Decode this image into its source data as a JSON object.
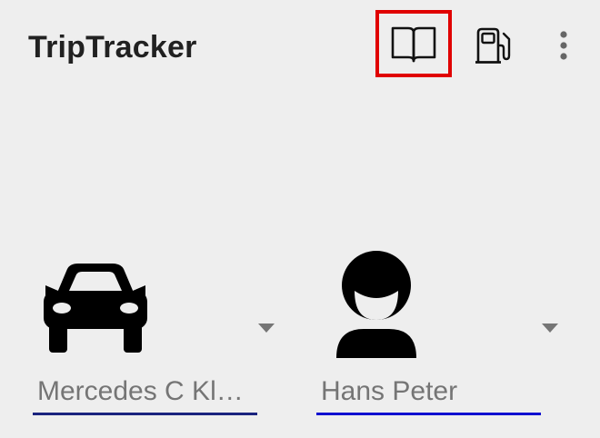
{
  "app": {
    "title": "TripTracker"
  },
  "toolbar": {
    "actions": [
      {
        "icon": "book-open-icon",
        "highlighted": true,
        "highlight_color": "#e00000"
      },
      {
        "icon": "fuel-pump-icon"
      },
      {
        "icon": "more-vert-icon"
      }
    ]
  },
  "selectors": {
    "vehicle": {
      "icon": "car-icon",
      "value": "Mercedes C Kl…",
      "underline_color": "#1a237e"
    },
    "driver": {
      "icon": "person-smiling-icon",
      "value": "Hans Peter",
      "underline_color": "#1010d0"
    }
  },
  "colors": {
    "background": "#eeeeee",
    "title_text": "#212121",
    "value_text": "#757575"
  }
}
